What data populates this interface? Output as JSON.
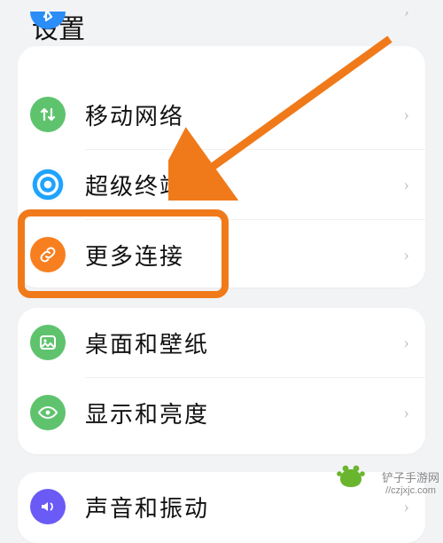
{
  "title": "设置",
  "groups": [
    {
      "peeking": true,
      "items": [
        {
          "icon": "bluetooth-icon",
          "color": "ic-blue",
          "label": ""
        },
        {
          "icon": "up-down-icon",
          "color": "ic-green",
          "label": "移动网络"
        },
        {
          "icon": "target-icon",
          "color": "ic-cyan",
          "label": "超级终端"
        },
        {
          "icon": "link-icon",
          "color": "ic-orange",
          "label": "更多连接",
          "highlighted": true
        }
      ]
    },
    {
      "items": [
        {
          "icon": "image-icon",
          "color": "ic-img",
          "label": "桌面和壁纸"
        },
        {
          "icon": "eye-icon",
          "color": "ic-eye",
          "label": "显示和亮度"
        }
      ]
    },
    {
      "items": [
        {
          "icon": "sound-icon",
          "color": "ic-purple",
          "label": "声音和振动"
        }
      ]
    }
  ],
  "watermark": {
    "line1": "铲子手游网",
    "line2": "//czjxjc.com"
  },
  "colors": {
    "highlight": "#f07a1a"
  }
}
